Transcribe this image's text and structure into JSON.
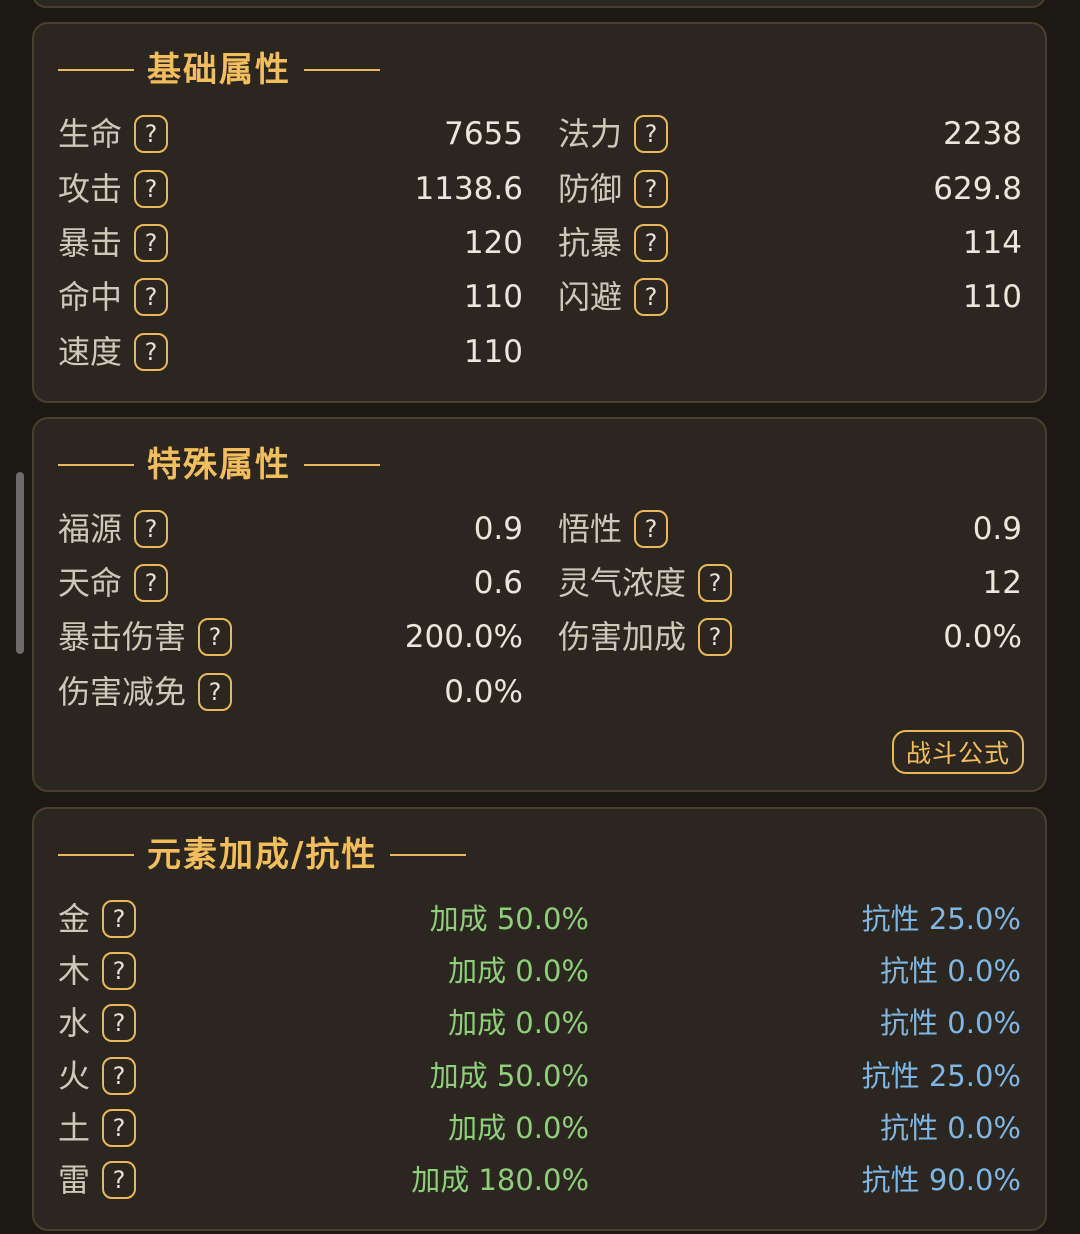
{
  "basic": {
    "title": "基础属性",
    "help": "?",
    "left": [
      {
        "label": "生命",
        "value": "7655"
      },
      {
        "label": "攻击",
        "value": "1138.6"
      },
      {
        "label": "暴击",
        "value": "120"
      },
      {
        "label": "命中",
        "value": "110"
      },
      {
        "label": "速度",
        "value": "110"
      }
    ],
    "right": [
      {
        "label": "法力",
        "value": "2238"
      },
      {
        "label": "防御",
        "value": "629.8"
      },
      {
        "label": "抗暴",
        "value": "114"
      },
      {
        "label": "闪避",
        "value": "110"
      }
    ]
  },
  "special": {
    "title": "特殊属性",
    "left": [
      {
        "label": "福源",
        "value": "0.9"
      },
      {
        "label": "天命",
        "value": "0.6"
      },
      {
        "label": "暴击伤害",
        "value": "200.0%"
      },
      {
        "label": "伤害减免",
        "value": "0.0%"
      }
    ],
    "right": [
      {
        "label": "悟性",
        "value": "0.9"
      },
      {
        "label": "灵气浓度",
        "value": "12"
      },
      {
        "label": "伤害加成",
        "value": "0.0%"
      }
    ],
    "formula_button": "战斗公式"
  },
  "elements": {
    "title": "元素加成/抗性",
    "rows": [
      {
        "label": "金",
        "bonus": "加成 50.0%",
        "resist": "抗性 25.0%"
      },
      {
        "label": "木",
        "bonus": "加成 0.0%",
        "resist": "抗性 0.0%"
      },
      {
        "label": "水",
        "bonus": "加成 0.0%",
        "resist": "抗性 0.0%"
      },
      {
        "label": "火",
        "bonus": "加成 50.0%",
        "resist": "抗性 25.0%"
      },
      {
        "label": "土",
        "bonus": "加成 0.0%",
        "resist": "抗性 0.0%"
      },
      {
        "label": "雷",
        "bonus": "加成 180.0%",
        "resist": "抗性 90.0%"
      }
    ]
  },
  "colors": {
    "accent_gold": "#e8b85a",
    "bonus_green": "#8fce7a",
    "resist_blue": "#7fb6e3",
    "panel_bg": "#2b2620",
    "page_bg": "#1c1915"
  }
}
